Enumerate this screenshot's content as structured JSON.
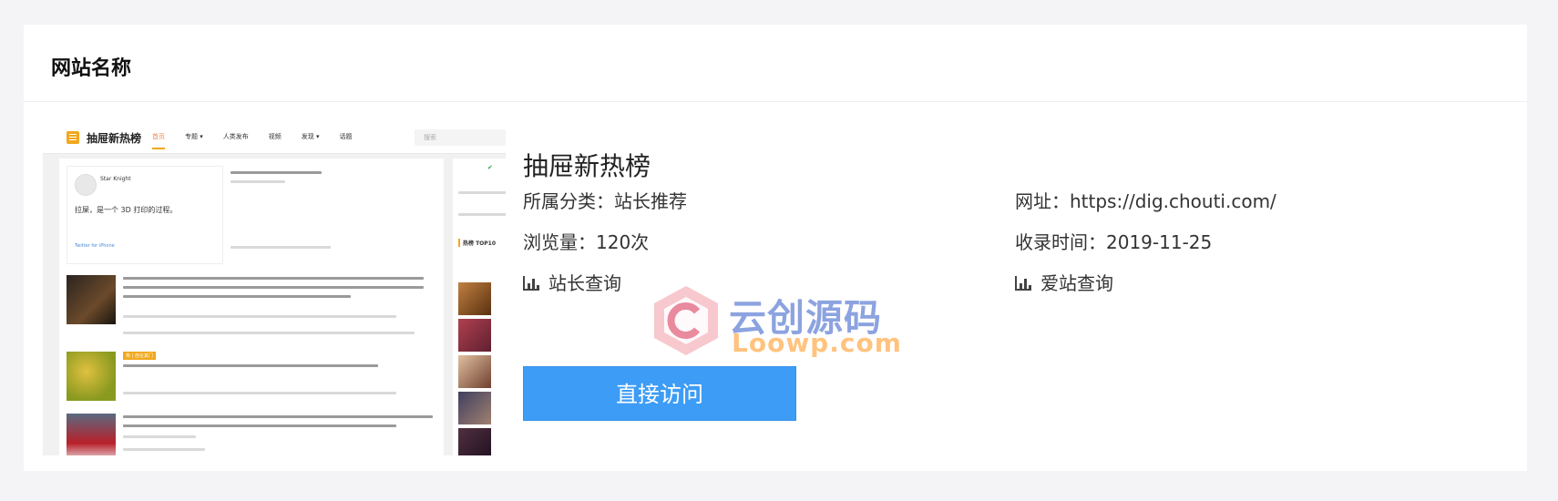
{
  "card": {
    "title": "网站名称"
  },
  "site": {
    "name": "抽屉新热榜",
    "category_label": "所属分类：",
    "category_value": "站长推荐",
    "url_label": "网址：",
    "url_value": "https://dig.chouti.com/",
    "views_label": "浏览量：",
    "views_value": "120次",
    "date_label": "收录时间：",
    "date_value": "2019-11-25",
    "link_webmaster": "站长查询",
    "link_aizhan": "爱站查询",
    "visit_button": "直接访问"
  },
  "thumbnail": {
    "brand": "抽屉新热榜",
    "nav": [
      "首页",
      "专题 ▾",
      "人类发布",
      "视频",
      "发现 ▾",
      "话题"
    ],
    "search_placeholder": "搜索",
    "tweet_user": "Star Knight",
    "tweet_text": "拉屎，是一个 3D 打印的过程。",
    "tweet_meta": "Twitter for iPhone",
    "side_title": "热榜 TOP10",
    "badge": "热 | 自在其门"
  },
  "watermark": {
    "line1": "云创源码",
    "line2": "Loowp.com"
  },
  "colors": {
    "accent": "#3d9cf6",
    "brand_orange": "#f0a81c",
    "title_marker": "#ff5a4a"
  }
}
